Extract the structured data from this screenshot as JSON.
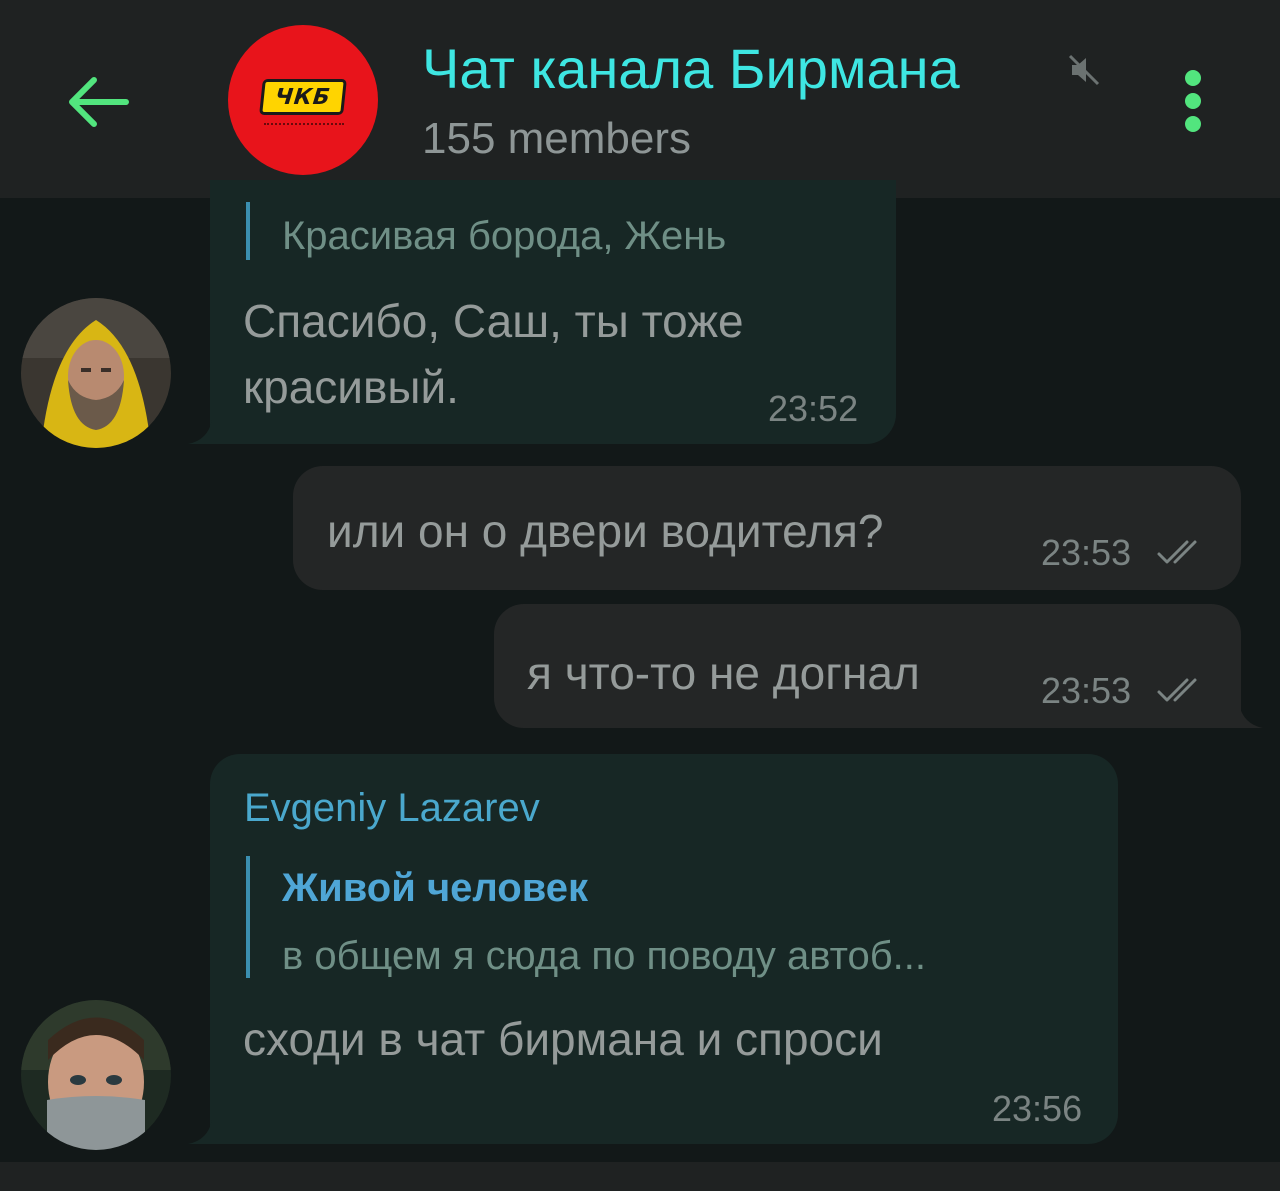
{
  "header": {
    "title": "Чат канала Бирмана",
    "members": "155 members",
    "avatar_logo": "ЧКБ",
    "accent_color": "#3ee6e2",
    "icons": [
      "back-arrow-icon",
      "muted-icon",
      "more-vertical-icon"
    ]
  },
  "messages": [
    {
      "direction": "incoming",
      "reply_snippet": "Красивая борода, Жень",
      "text_line1": "Спасибо, Саш, ты тоже",
      "text_line2": "красивый.",
      "time": "23:52"
    },
    {
      "direction": "outgoing",
      "text": "или он о двери водителя?",
      "time": "23:53",
      "status": "read"
    },
    {
      "direction": "outgoing",
      "text": "я что-то не догнал",
      "time": "23:53",
      "status": "read"
    },
    {
      "direction": "incoming",
      "sender": "Evgeniy Lazarev",
      "reply_name": "Живой человек",
      "reply_snippet": "в общем я сюда по поводу автоб...",
      "text": "сходи в чат бирмана и спроси",
      "time": "23:56"
    }
  ]
}
